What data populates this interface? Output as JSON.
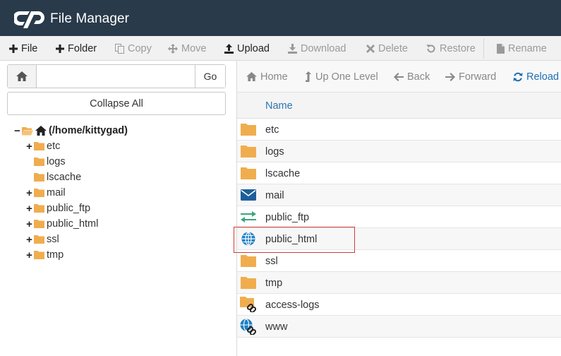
{
  "app": {
    "title": "File Manager"
  },
  "toolbar": {
    "items": [
      {
        "label": "File",
        "icon": "plus-icon",
        "enabled": true
      },
      {
        "label": "Folder",
        "icon": "plus-icon",
        "enabled": true
      },
      {
        "label": "Copy",
        "icon": "copy-icon",
        "enabled": false
      },
      {
        "label": "Move",
        "icon": "move-icon",
        "enabled": false
      },
      {
        "label": "Upload",
        "icon": "upload-icon",
        "enabled": true
      },
      {
        "label": "Download",
        "icon": "download-icon",
        "enabled": false
      },
      {
        "label": "Delete",
        "icon": "delete-icon",
        "enabled": false
      },
      {
        "label": "Restore",
        "icon": "restore-icon",
        "enabled": false
      },
      {
        "label": "Rename",
        "icon": "file-icon",
        "enabled": false
      }
    ]
  },
  "path_bar": {
    "value": "",
    "go_label": "Go"
  },
  "collapse_label": "Collapse All",
  "tree": {
    "root_label": "(/home/kittygad)",
    "items": [
      {
        "label": "etc",
        "expandable": true
      },
      {
        "label": "logs",
        "expandable": false
      },
      {
        "label": "lscache",
        "expandable": false
      },
      {
        "label": "mail",
        "expandable": true
      },
      {
        "label": "public_ftp",
        "expandable": true
      },
      {
        "label": "public_html",
        "expandable": true
      },
      {
        "label": "ssl",
        "expandable": true
      },
      {
        "label": "tmp",
        "expandable": true
      }
    ]
  },
  "nav": {
    "home": "Home",
    "up": "Up One Level",
    "back": "Back",
    "forward": "Forward",
    "reload": "Reload"
  },
  "table": {
    "header_name": "Name",
    "rows": [
      {
        "name": "etc",
        "icon": "folder-icon"
      },
      {
        "name": "logs",
        "icon": "folder-icon"
      },
      {
        "name": "lscache",
        "icon": "folder-icon"
      },
      {
        "name": "mail",
        "icon": "envelope-icon"
      },
      {
        "name": "public_ftp",
        "icon": "exchange-arrows-icon"
      },
      {
        "name": "public_html",
        "icon": "globe-icon"
      },
      {
        "name": "ssl",
        "icon": "folder-icon"
      },
      {
        "name": "tmp",
        "icon": "folder-icon"
      },
      {
        "name": "access-logs",
        "icon": "folder-link-icon"
      },
      {
        "name": "www",
        "icon": "globe-link-icon"
      }
    ]
  },
  "colors": {
    "header_bg": "#293a4a",
    "folder": "#f0ad4e",
    "link_blue": "#2f74b5",
    "highlight": "#d33a3a",
    "globe": "#1d7fc2",
    "mail": "#1d5f9a",
    "ftp": "#3aa57a"
  }
}
